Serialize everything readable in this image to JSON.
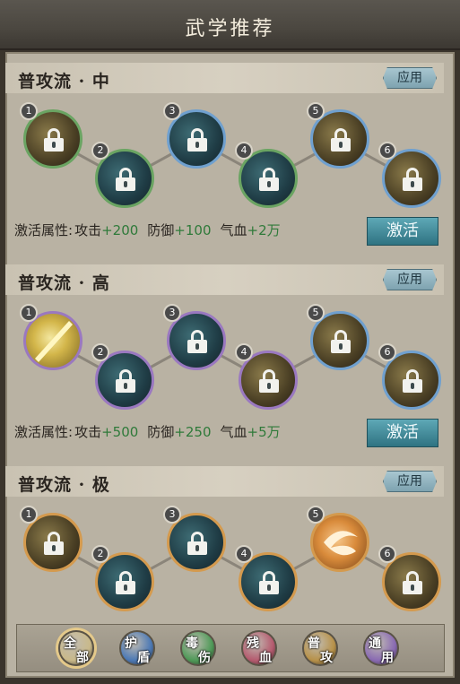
{
  "header": {
    "title": "武学推荐"
  },
  "sections": [
    {
      "title": "普攻流 · 中",
      "apply_label": "应用",
      "skills": [
        {
          "num": "1",
          "rank": "green",
          "style": "gold",
          "locked": true,
          "icon": "lock-icon"
        },
        {
          "num": "2",
          "rank": "green",
          "style": "teal",
          "locked": true,
          "icon": "lock-icon"
        },
        {
          "num": "3",
          "rank": "blue",
          "style": "teal",
          "locked": true,
          "icon": "lock-icon"
        },
        {
          "num": "4",
          "rank": "green",
          "style": "teal",
          "locked": true,
          "icon": "lock-icon"
        },
        {
          "num": "5",
          "rank": "blue",
          "style": "gold",
          "locked": true,
          "icon": "lock-icon"
        },
        {
          "num": "6",
          "rank": "blue",
          "style": "gold",
          "locked": true,
          "icon": "lock-icon"
        }
      ],
      "attr_label": "激活属性:",
      "attrs": [
        {
          "name": "攻击",
          "value": "+200"
        },
        {
          "name": "防御",
          "value": "+100"
        },
        {
          "name": "气血",
          "value": "+2万"
        }
      ],
      "activate_label": "激活"
    },
    {
      "title": "普攻流 · 高",
      "apply_label": "应用",
      "skills": [
        {
          "num": "1",
          "rank": "purple",
          "style": "bright",
          "locked": false,
          "icon": "sword-icon"
        },
        {
          "num": "2",
          "rank": "purple",
          "style": "teal",
          "locked": true,
          "icon": "lock-icon"
        },
        {
          "num": "3",
          "rank": "purple",
          "style": "teal",
          "locked": true,
          "icon": "lock-icon"
        },
        {
          "num": "4",
          "rank": "purple",
          "style": "gold",
          "locked": true,
          "icon": "lock-icon"
        },
        {
          "num": "5",
          "rank": "blue",
          "style": "gold",
          "locked": true,
          "icon": "lock-icon"
        },
        {
          "num": "6",
          "rank": "blue",
          "style": "gold",
          "locked": true,
          "icon": "lock-icon"
        }
      ],
      "attr_label": "激活属性:",
      "attrs": [
        {
          "name": "攻击",
          "value": "+500"
        },
        {
          "name": "防御",
          "value": "+250"
        },
        {
          "name": "气血",
          "value": "+5万"
        }
      ],
      "activate_label": "激活"
    },
    {
      "title": "普攻流 · 极",
      "apply_label": "应用",
      "skills": [
        {
          "num": "1",
          "rank": "orange",
          "style": "gold",
          "locked": true,
          "icon": "lock-icon"
        },
        {
          "num": "2",
          "rank": "orange",
          "style": "teal",
          "locked": true,
          "icon": "lock-icon"
        },
        {
          "num": "3",
          "rank": "orange",
          "style": "teal",
          "locked": true,
          "icon": "lock-icon"
        },
        {
          "num": "4",
          "rank": "orange",
          "style": "teal",
          "locked": true,
          "icon": "lock-icon"
        },
        {
          "num": "5",
          "rank": "orange",
          "style": "amber",
          "locked": false,
          "icon": "blade-icon"
        },
        {
          "num": "6",
          "rank": "orange",
          "style": "gold",
          "locked": true,
          "icon": "lock-icon"
        }
      ]
    }
  ],
  "filters": [
    {
      "top": "全",
      "bottom": "部",
      "color": "#c9b98a",
      "active": true
    },
    {
      "top": "护",
      "bottom": "盾",
      "color": "#4c79b5",
      "active": false
    },
    {
      "top": "毒",
      "bottom": "伤",
      "color": "#4f9a58",
      "active": false
    },
    {
      "top": "残",
      "bottom": "血",
      "color": "#b55b6f",
      "active": false
    },
    {
      "top": "普",
      "bottom": "攻",
      "color": "#b8924a",
      "active": false
    },
    {
      "top": "通",
      "bottom": "用",
      "color": "#8a6bb3",
      "active": false
    }
  ],
  "colors": {
    "green": "#6aa462",
    "blue": "#6fa0cf",
    "purple": "#9a78c0",
    "orange": "#d49a4e",
    "plus": "#2f7a3a",
    "activate_bg": "#3f8a98"
  }
}
